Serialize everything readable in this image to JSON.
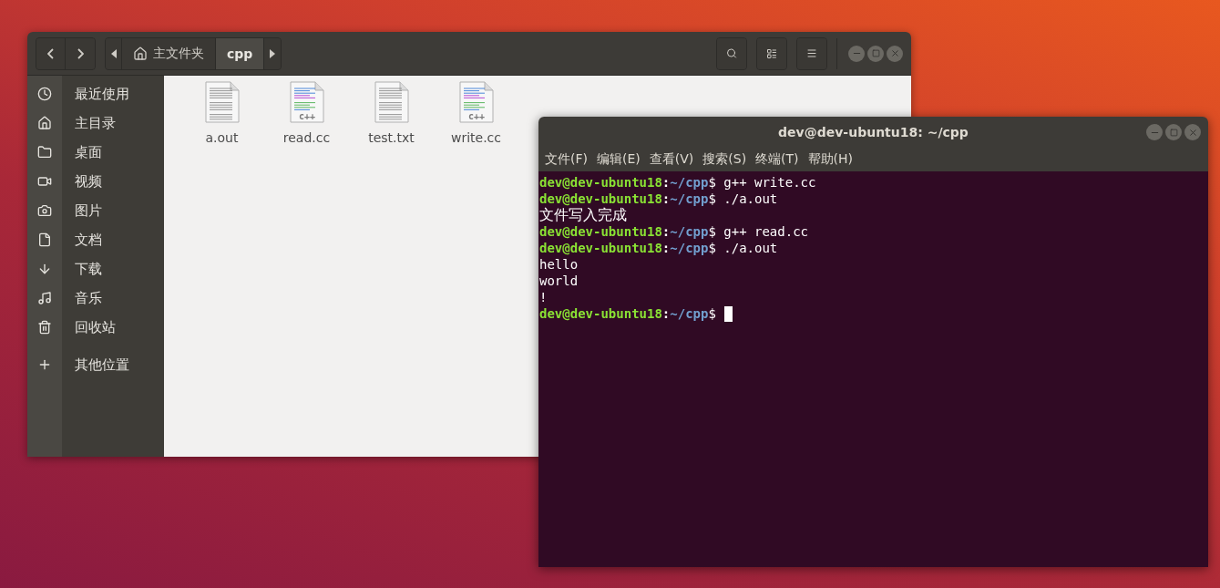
{
  "file_manager": {
    "breadcrumbs": [
      {
        "label": "主文件夹",
        "kind": "home",
        "selected": false
      },
      {
        "label": "cpp",
        "kind": "folder",
        "selected": true
      }
    ],
    "sidebar": {
      "items": [
        {
          "label": "最近使用",
          "kind": "recent"
        },
        {
          "label": "主目录",
          "kind": "home"
        },
        {
          "label": "桌面",
          "kind": "desktop"
        },
        {
          "label": "视频",
          "kind": "video"
        },
        {
          "label": "图片",
          "kind": "pictures"
        },
        {
          "label": "文档",
          "kind": "documents"
        },
        {
          "label": "下载",
          "kind": "downloads"
        },
        {
          "label": "音乐",
          "kind": "music"
        },
        {
          "label": "回收站",
          "kind": "trash"
        },
        {
          "label": "其他位置",
          "kind": "other"
        }
      ]
    },
    "files": [
      {
        "name": "a.out",
        "kind": "text"
      },
      {
        "name": "read.cc",
        "kind": "cpp",
        "badge": "c++"
      },
      {
        "name": "test.txt",
        "kind": "text"
      },
      {
        "name": "write.cc",
        "kind": "cpp",
        "badge": "c++"
      }
    ]
  },
  "terminal": {
    "title": "dev@dev-ubuntu18: ~/cpp",
    "menu": [
      "文件(F)",
      "编辑(E)",
      "查看(V)",
      "搜索(S)",
      "终端(T)",
      "帮助(H)"
    ],
    "lines": [
      {
        "kind": "prompt",
        "user": "dev@dev-ubuntu18",
        "separator": ":",
        "path": "~/cpp",
        "symbol": "$",
        "command": "g++ write.cc"
      },
      {
        "kind": "prompt",
        "user": "dev@dev-ubuntu18",
        "separator": ":",
        "path": "~/cpp",
        "symbol": "$",
        "command": "./a.out"
      },
      {
        "kind": "output",
        "text": "文件写入完成"
      },
      {
        "kind": "prompt",
        "user": "dev@dev-ubuntu18",
        "separator": ":",
        "path": "~/cpp",
        "symbol": "$",
        "command": "g++ read.cc"
      },
      {
        "kind": "prompt",
        "user": "dev@dev-ubuntu18",
        "separator": ":",
        "path": "~/cpp",
        "symbol": "$",
        "command": "./a.out"
      },
      {
        "kind": "output",
        "text": "hello"
      },
      {
        "kind": "output",
        "text": "world"
      },
      {
        "kind": "output",
        "text": "!"
      },
      {
        "kind": "prompt",
        "user": "dev@dev-ubuntu18",
        "separator": ":",
        "path": "~/cpp",
        "symbol": "$",
        "cursor": true
      }
    ]
  }
}
